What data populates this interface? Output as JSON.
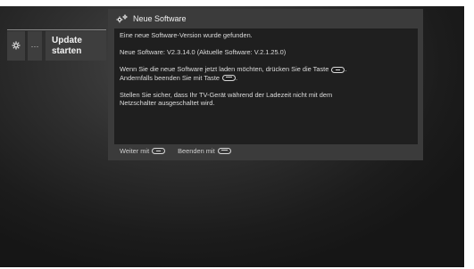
{
  "menu": {
    "settings_icon": "gear-icon",
    "more_label": "···",
    "update_line1": "Update",
    "update_line2": "starten"
  },
  "dialog": {
    "icon": "gears-icon",
    "title": "Neue Software",
    "line1": "Eine neue Software-Version wurde gefunden.",
    "line2": "Neue Software:  V2.3.14.0   (Aktuelle Software:  V.2.1.25.0)",
    "line3a": "Wenn Sie die neue Software jetzt laden möchten, drücken Sie die Taste",
    "line3b": "Andernfalls beenden Sie mit Taste",
    "line4a": "Stellen Sie sicher, dass Ihr TV-Gerät während der Ladezeit nicht mit dem",
    "line4b": "Netzschalter ausgeschaltet wird."
  },
  "footer": {
    "continue_label": "Weiter mit",
    "exit_label": "Beenden mit"
  },
  "colors": {
    "background": "#2a2a2a",
    "dialog": "#3b3b3b",
    "body": "#1f1f1f"
  }
}
